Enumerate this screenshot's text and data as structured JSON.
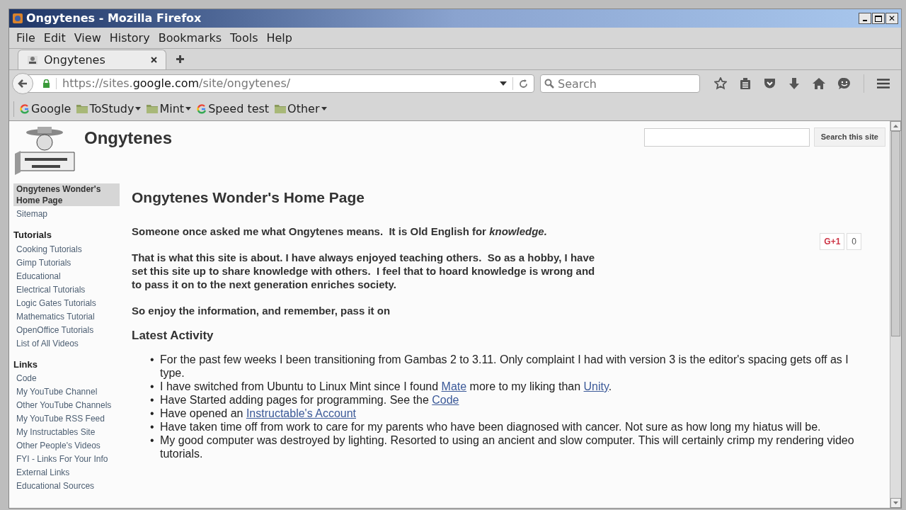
{
  "window": {
    "title": "Ongytenes - Mozilla Firefox",
    "close": "✕"
  },
  "menu": [
    "File",
    "Edit",
    "View",
    "History",
    "Bookmarks",
    "Tools",
    "Help"
  ],
  "tabs": [
    {
      "label": "Ongytenes",
      "selected": true
    }
  ],
  "url": {
    "prefix": "https://sites.",
    "domain": "google.com",
    "path": "/site/ongytenes/"
  },
  "search": {
    "placeholder": "Search"
  },
  "bookmarks": [
    {
      "label": "Google",
      "kind": "google"
    },
    {
      "label": "ToStudy",
      "kind": "folder"
    },
    {
      "label": "Mint",
      "kind": "folder"
    },
    {
      "label": "Speed test",
      "kind": "google"
    },
    {
      "label": "Other",
      "kind": "folder"
    }
  ],
  "site": {
    "title": "Ongytenes",
    "search_button": "Search this site"
  },
  "sidebar": [
    {
      "label": "Ongytenes Wonder's Home Page",
      "kind": "link",
      "selected": true
    },
    {
      "label": "Sitemap",
      "kind": "link",
      "selected": false
    },
    {
      "label": "Tutorials",
      "kind": "heading"
    },
    {
      "label": "Cooking Tutorials",
      "kind": "link",
      "selected": false
    },
    {
      "label": "Gimp Tutorials",
      "kind": "link",
      "selected": false
    },
    {
      "label": "Educational",
      "kind": "link",
      "selected": false
    },
    {
      "label": "Electrical Tutorials",
      "kind": "link",
      "selected": false
    },
    {
      "label": "Logic Gates Tutorials",
      "kind": "link",
      "selected": false
    },
    {
      "label": "Mathematics Tutorial",
      "kind": "link",
      "selected": false
    },
    {
      "label": "OpenOffice Tutorials",
      "kind": "link",
      "selected": false
    },
    {
      "label": "List of All Videos",
      "kind": "link",
      "selected": false
    },
    {
      "label": "Links",
      "kind": "heading"
    },
    {
      "label": "Code",
      "kind": "link",
      "selected": false
    },
    {
      "label": "My YouTube Channel",
      "kind": "link",
      "selected": false
    },
    {
      "label": "Other YouTube Channels",
      "kind": "link",
      "selected": false
    },
    {
      "label": "My YouTube RSS Feed",
      "kind": "link",
      "selected": false
    },
    {
      "label": "My Instructables Site",
      "kind": "link",
      "selected": false
    },
    {
      "label": "Other People's Videos",
      "kind": "link",
      "selected": false
    },
    {
      "label": "FYI - Links For Your Info",
      "kind": "link",
      "selected": false
    },
    {
      "label": "External Links",
      "kind": "link",
      "selected": false
    },
    {
      "label": "Educational Sources",
      "kind": "link",
      "selected": false
    }
  ],
  "page": {
    "heading": "Ongytenes Wonder's Home Page",
    "paragraphs": [
      "Someone once asked me what Ongytenes means.  It is Old English for *knowledge.*",
      "That is what this site is about. I have always enjoyed teaching others.  So as a hobby, I have set this site up to share knowledge with others.  I feel that to hoard knowledge is wrong and to pass it on to the next generation enriches society.",
      "So enjoy the information, and remember, pass it on"
    ],
    "plusone": {
      "label": "G+1",
      "count": "0"
    },
    "activity_heading": "Latest Activity",
    "activity": [
      {
        "bullet": "•",
        "parts": [
          {
            "kind": "text",
            "text": "For the past few weeks I been transitioning from Gambas 2 to 3.11. Only complaint I had with version 3 is the editor's spacing gets off as I type."
          }
        ]
      },
      {
        "bullet": "•",
        "parts": [
          {
            "kind": "text",
            "text": "I have switched from Ubuntu to Linux Mint since I found "
          },
          {
            "kind": "link",
            "text": "Mate"
          },
          {
            "kind": "text",
            "text": " more to my liking than "
          },
          {
            "kind": "link",
            "text": "Unity"
          },
          {
            "kind": "text",
            "text": "."
          }
        ]
      },
      {
        "bullet": "•",
        "parts": [
          {
            "kind": "text",
            "text": "Have Started adding pages for programming. See the "
          },
          {
            "kind": "link",
            "text": "Code"
          }
        ]
      },
      {
        "bullet": "•",
        "parts": [
          {
            "kind": "text",
            "text": "Have opened an "
          },
          {
            "kind": "link",
            "text": "Instructable's Account"
          }
        ]
      },
      {
        "bullet": "•",
        "parts": [
          {
            "kind": "text",
            "text": "Have taken time off from work to care for my parents who have been diagnosed with cancer. Not sure as how long my hiatus will be."
          }
        ]
      },
      {
        "bullet": "•",
        "parts": [
          {
            "kind": "text",
            "text": "My good computer was destroyed by lighting. Resorted to using an ancient and slow computer. This will certainly crimp my rendering video tutorials."
          }
        ]
      }
    ]
  }
}
